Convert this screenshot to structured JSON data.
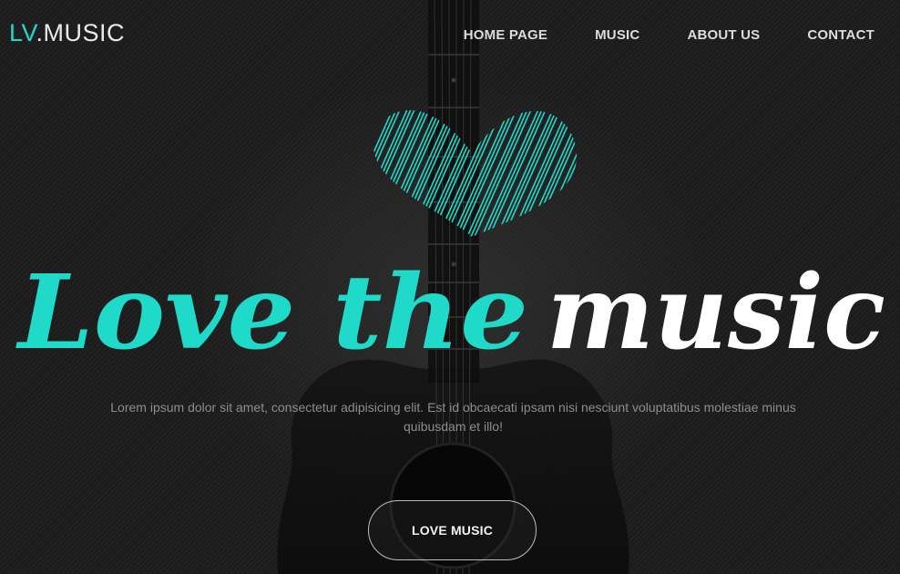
{
  "brand": {
    "prefix": "LV",
    "suffix": ".MUSIC",
    "accent_color": "#1fd9c9"
  },
  "nav": {
    "items": [
      {
        "label": "HOME PAGE"
      },
      {
        "label": "MUSIC"
      },
      {
        "label": "ABOUT US"
      },
      {
        "label": "CONTACT"
      }
    ]
  },
  "hero": {
    "heart_icon": "heart-icon",
    "headline_part1": "Love the",
    "headline_part2": "music",
    "headline_part1_color": "#1fd9c9",
    "headline_part2_color": "#ffffff",
    "tagline": "Lorem ipsum dolor sit amet, consectetur adipisicing elit. Est id obcaecati ipsam nisi nesciunt voluptatibus molestiae minus quibusdam et illo!",
    "cta_label": "LOVE MUSIC",
    "background_image": "acoustic guitar"
  }
}
